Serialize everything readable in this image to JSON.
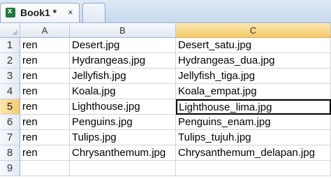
{
  "tabs": {
    "active_title": "Book1 *",
    "close_glyph": "×",
    "app_icon_letter": "x"
  },
  "columns": [
    "A",
    "B",
    "C"
  ],
  "selected_column": "C",
  "selected_row": "5",
  "rows": [
    {
      "num": "1",
      "cells": [
        "ren",
        "Desert.jpg",
        "Desert_satu.jpg"
      ]
    },
    {
      "num": "2",
      "cells": [
        "ren",
        "Hydrangeas.jpg",
        "Hydrangeas_dua.jpg"
      ]
    },
    {
      "num": "3",
      "cells": [
        "ren",
        "Jellyfish.jpg",
        "Jellyfish_tiga.jpg"
      ]
    },
    {
      "num": "4",
      "cells": [
        "ren",
        "Koala.jpg",
        "Koala_empat.jpg"
      ]
    },
    {
      "num": "5",
      "cells": [
        "ren",
        "Lighthouse.jpg",
        "Lighthouse_lima.jpg"
      ]
    },
    {
      "num": "6",
      "cells": [
        "ren",
        "Penguins.jpg",
        "Penguins_enam.jpg"
      ]
    },
    {
      "num": "7",
      "cells": [
        "ren",
        "Tulips.jpg",
        "Tulips_tujuh.jpg"
      ]
    },
    {
      "num": "8",
      "cells": [
        "ren",
        "Chrysanthemum.jpg",
        "Chrysanthemum_delapan.jpg"
      ]
    },
    {
      "num": "9",
      "cells": [
        "",
        "",
        ""
      ]
    }
  ]
}
